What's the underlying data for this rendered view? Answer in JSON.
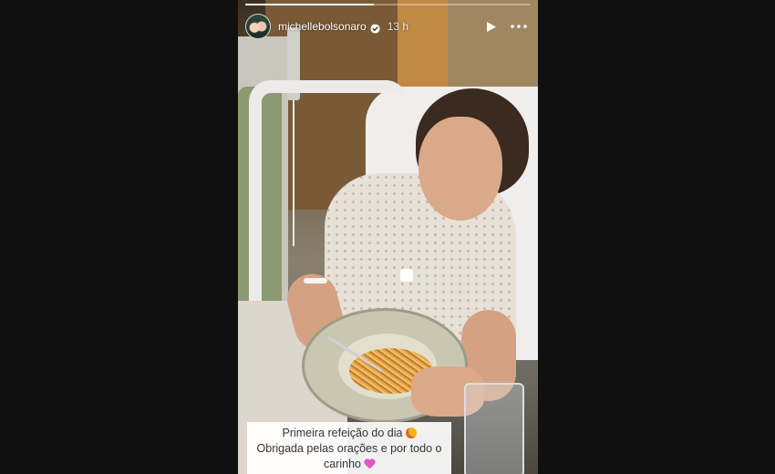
{
  "story": {
    "username": "michellebolsonaro",
    "time_ago": "13 h",
    "progress": 0.45,
    "caption": {
      "line1": "Primeira refeição do dia",
      "line2": "Obrigada pelas orações e por todo o",
      "line3": "carinho"
    },
    "icons": {
      "avatar": "avatar",
      "verified": "verified-badge-icon",
      "play": "play-icon",
      "more": "more-options-icon",
      "emoji1": "star-struck-emoji",
      "emoji2": "pink-heart-emoji"
    }
  }
}
